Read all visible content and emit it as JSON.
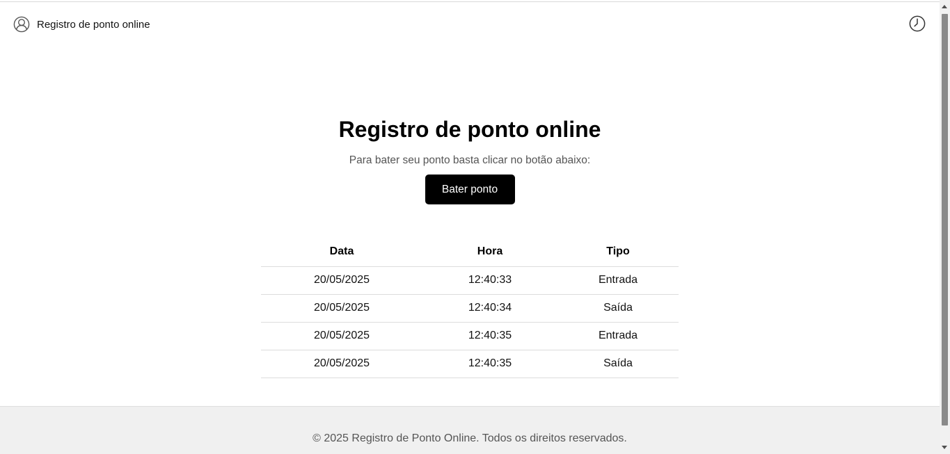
{
  "header": {
    "brand_icon": "user-circle-icon",
    "brand_title": "Registro de ponto online",
    "history_icon": "clock-icon"
  },
  "main": {
    "title": "Registro de ponto online",
    "subtitle": "Para bater seu ponto basta clicar no botão abaixo:",
    "button_label": "Bater ponto"
  },
  "table": {
    "headers": [
      "Data",
      "Hora",
      "Tipo"
    ],
    "rows": [
      [
        "20/05/2025",
        "12:40:33",
        "Entrada"
      ],
      [
        "20/05/2025",
        "12:40:34",
        "Saída"
      ],
      [
        "20/05/2025",
        "12:40:35",
        "Entrada"
      ],
      [
        "20/05/2025",
        "12:40:35",
        "Saída"
      ]
    ]
  },
  "footer": {
    "text": "© 2025 Registro de Ponto Online. Todos os direitos reservados."
  },
  "colors": {
    "button_bg": "#000000",
    "footer_bg": "#f0f0f0",
    "text_muted": "#555555"
  }
}
